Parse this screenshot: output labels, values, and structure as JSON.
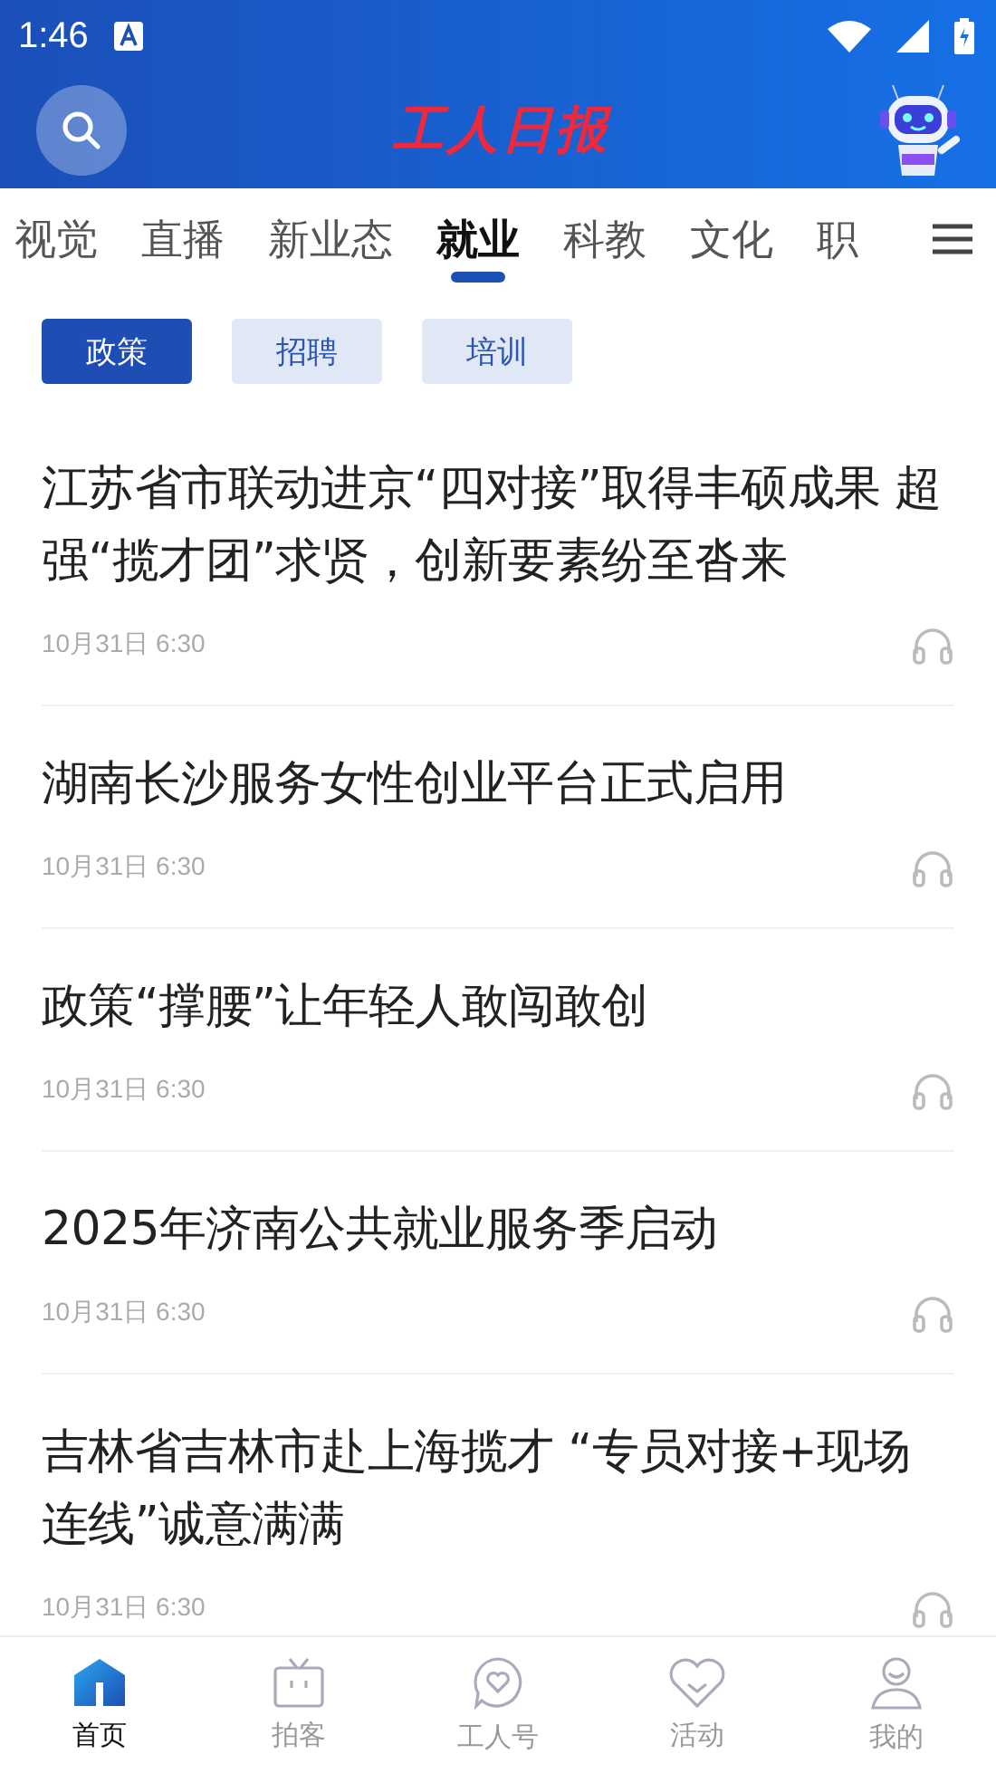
{
  "status_bar": {
    "time": "1:46"
  },
  "header": {
    "logo": "工人日报"
  },
  "channels": [
    {
      "label": "视觉",
      "selected": false
    },
    {
      "label": "直播",
      "selected": false
    },
    {
      "label": "新业态",
      "selected": false
    },
    {
      "label": "就业",
      "selected": true
    },
    {
      "label": "科教",
      "selected": false
    },
    {
      "label": "文化",
      "selected": false
    },
    {
      "label": "职",
      "selected": false
    }
  ],
  "filters": [
    {
      "label": "政策",
      "selected": true
    },
    {
      "label": "招聘",
      "selected": false
    },
    {
      "label": "培训",
      "selected": false
    }
  ],
  "articles": [
    {
      "title": "江苏省市联动进京“四对接”取得丰硕成果 超强“揽才团”求贤，创新要素纷至沓来",
      "date": "10月31日 6:30"
    },
    {
      "title": "湖南长沙服务女性创业平台正式启用",
      "date": "10月31日 6:30"
    },
    {
      "title": "政策“撑腰”让年轻人敢闯敢创",
      "date": "10月31日 6:30"
    },
    {
      "title": "2025年济南公共就业服务季启动",
      "date": "10月31日 6:30"
    },
    {
      "title": "吉林省吉林市赴上海揽才 “专员对接+现场连线”诚意满满",
      "date": "10月31日 6:30"
    }
  ],
  "bottom_nav": [
    {
      "label": "首页",
      "selected": true
    },
    {
      "label": "拍客",
      "selected": false
    },
    {
      "label": "工人号",
      "selected": false
    },
    {
      "label": "活动",
      "selected": false
    },
    {
      "label": "我的",
      "selected": false
    }
  ]
}
